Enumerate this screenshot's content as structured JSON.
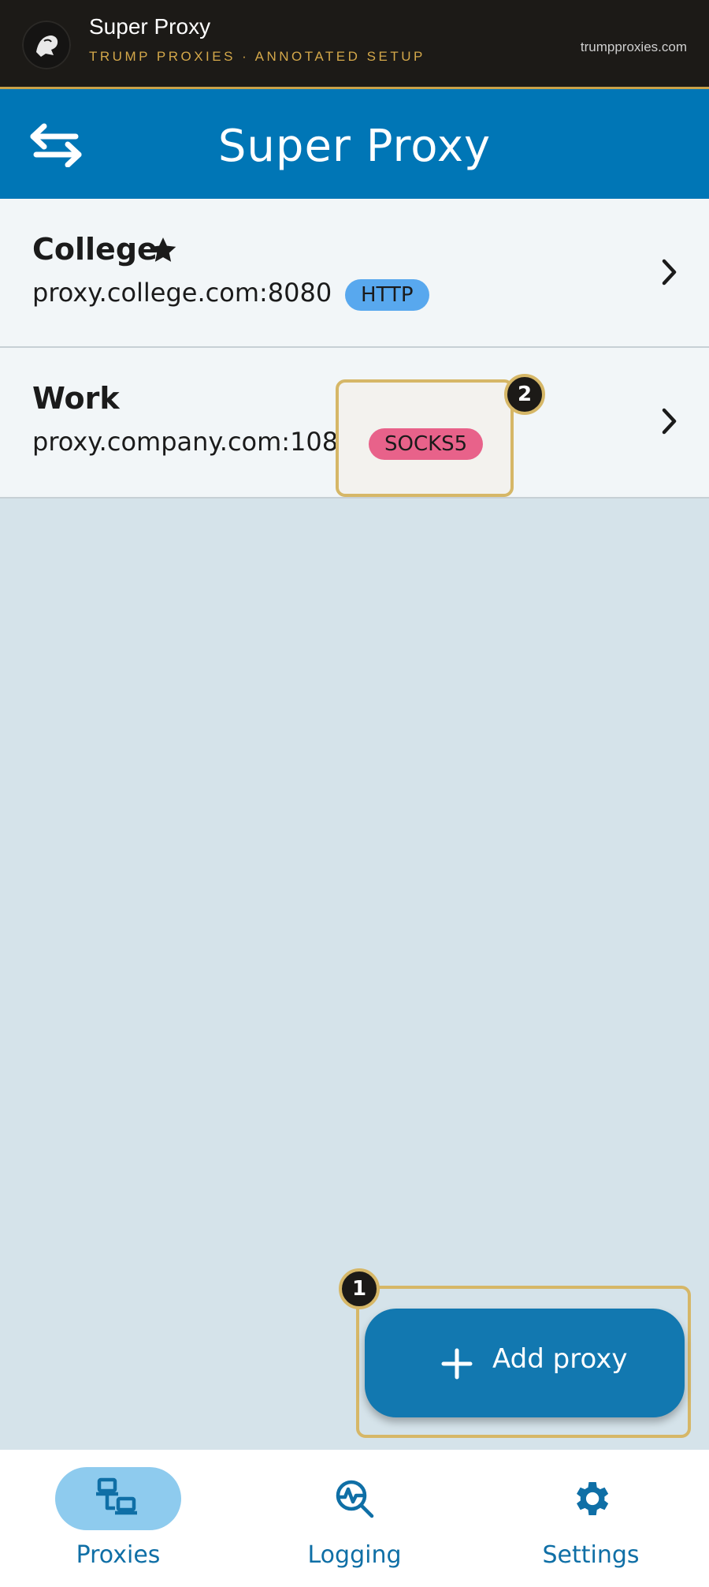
{
  "banner": {
    "title": "Super Proxy",
    "subtitle": "TRUMP PROXIES · ANNOTATED SETUP",
    "url": "trumpproxies.com"
  },
  "appbar": {
    "title": "Super Proxy"
  },
  "proxies": [
    {
      "name": "College",
      "host": "proxy.college.com:8080",
      "protocol": "HTTP",
      "favorite": true,
      "badge_color": "#58a8ee"
    },
    {
      "name": "Work",
      "host": "proxy.company.com:1080",
      "protocol": "SOCKS5",
      "favorite": false,
      "badge_color": "#e8628a"
    }
  ],
  "annotations": [
    {
      "number": "1",
      "target": "add-proxy-button"
    },
    {
      "number": "2",
      "target": "protocol-badge-socks5"
    }
  ],
  "fab": {
    "label": "Add proxy"
  },
  "nav": [
    {
      "label": "Proxies",
      "icon": "network-computers-icon",
      "active": true
    },
    {
      "label": "Logging",
      "icon": "search-activity-icon",
      "active": false
    },
    {
      "label": "Settings",
      "icon": "gear-icon",
      "active": false
    }
  ],
  "colors": {
    "banner_bg": "#1c1a17",
    "brand_gold": "#d4a84a",
    "appbar": "#0076b6",
    "background": "#d5e3ea",
    "fab": "#1278b0",
    "nav_active_pill": "#8ecbee",
    "nav_text": "#0f6fa6"
  }
}
